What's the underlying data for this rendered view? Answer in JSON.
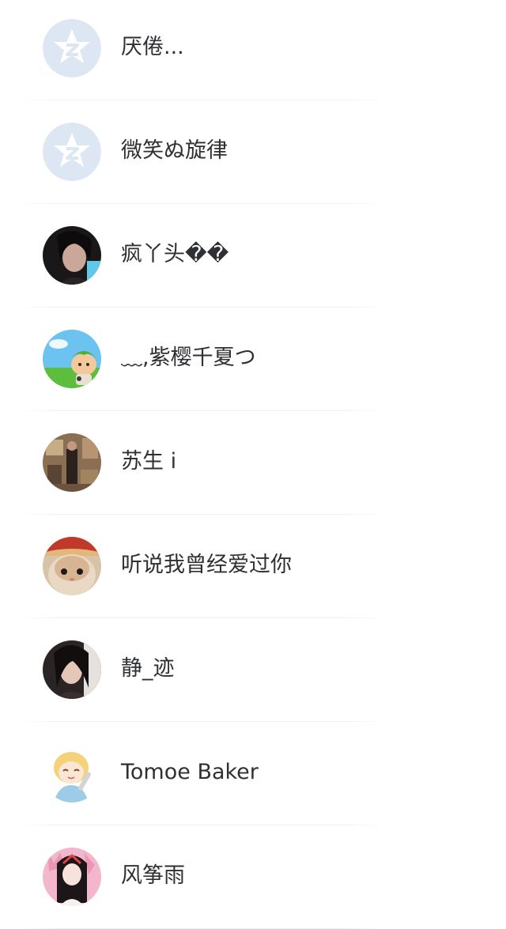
{
  "contacts": [
    {
      "name": "厌倦...",
      "avatar": "qq-default-star-icon"
    },
    {
      "name": "微笑ぬ旋律",
      "avatar": "qq-default-star-icon"
    },
    {
      "name": "疯丫头��",
      "avatar": "dark-portrait-photo"
    },
    {
      "name": "﹏,紫樱千夏つ",
      "avatar": "cartoon-mascot-meadow"
    },
    {
      "name": "苏生 i",
      "avatar": "room-photo"
    },
    {
      "name": "听说我曾经爱过你",
      "avatar": "hamster-photo"
    },
    {
      "name": "静_迹",
      "avatar": "dark-hair-portrait-photo"
    },
    {
      "name": "Tomoe Baker",
      "avatar": "anime-blonde-girl"
    },
    {
      "name": "风筝雨",
      "avatar": "pink-doll-photo"
    }
  ],
  "colors": {
    "background": "#ffffff",
    "name_text": "#2f3033",
    "divider": "#eef0f2",
    "default_avatar_bg": "#dde7f4",
    "default_avatar_star": "#ffffff"
  }
}
